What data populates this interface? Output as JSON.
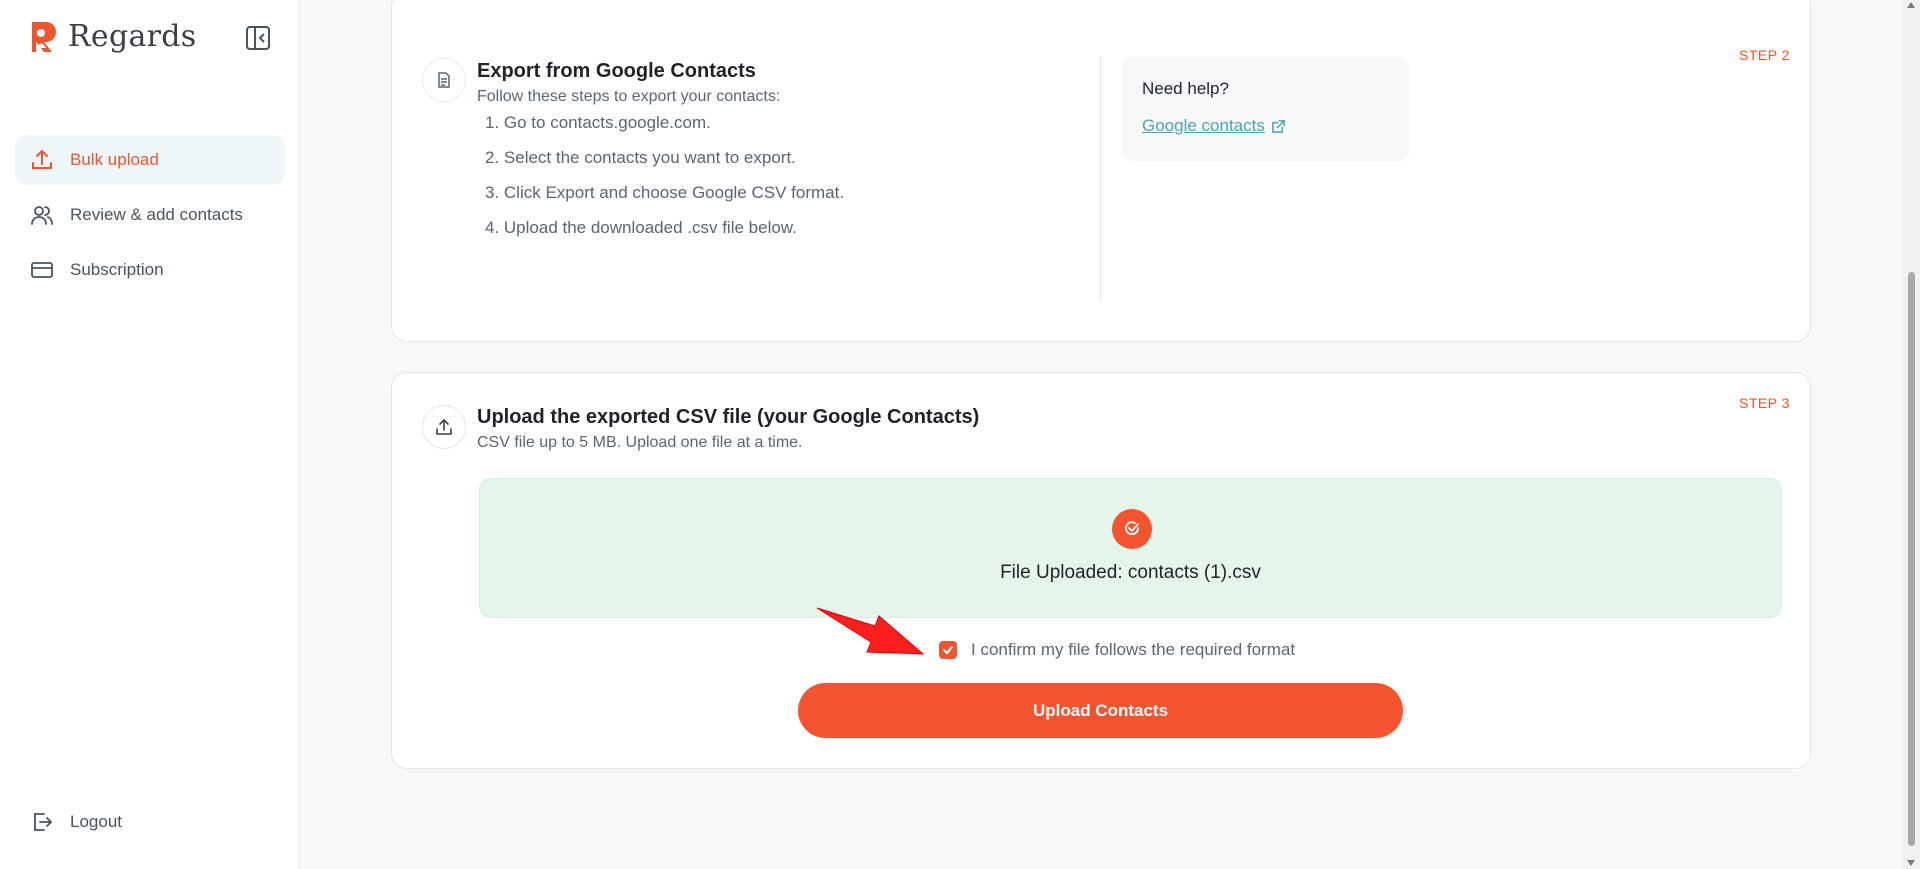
{
  "brand": {
    "name": "Regards",
    "accent": "#f0542d"
  },
  "sidebar": {
    "items": [
      {
        "label": "Bulk upload",
        "icon": "upload-icon",
        "active": true
      },
      {
        "label": "Review & add contacts",
        "icon": "users-icon",
        "active": false
      },
      {
        "label": "Subscription",
        "icon": "credit-card-icon",
        "active": false
      }
    ],
    "logout_label": "Logout"
  },
  "step2": {
    "step_label": "STEP 2",
    "icon": "document-icon",
    "title": "Export from Google Contacts",
    "subtitle": "Follow these steps to export your contacts:",
    "steps": [
      "1. Go to contacts.google.com.",
      "2. Select the contacts you want to export.",
      "3. Click Export and choose Google CSV format.",
      "4. Upload the downloaded .csv file below."
    ],
    "help": {
      "title": "Need help?",
      "link_label": "Google contacts",
      "link_icon": "external-link-icon"
    }
  },
  "step3": {
    "step_label": "STEP 3",
    "icon": "upload-icon",
    "title": "Upload the exported CSV file (your Google Contacts)",
    "subtitle": "CSV file up to 5 MB. Upload one file at a time.",
    "uploaded_text": "File Uploaded: contacts (1).csv",
    "success_icon": "check-circle-icon",
    "confirm_label": "I confirm my file follows the required format",
    "confirm_checked": true,
    "upload_button_label": "Upload Contacts"
  },
  "colors": {
    "accent": "#f4542f",
    "success_bg": "#e6f5ea",
    "link": "#4da3b0"
  }
}
